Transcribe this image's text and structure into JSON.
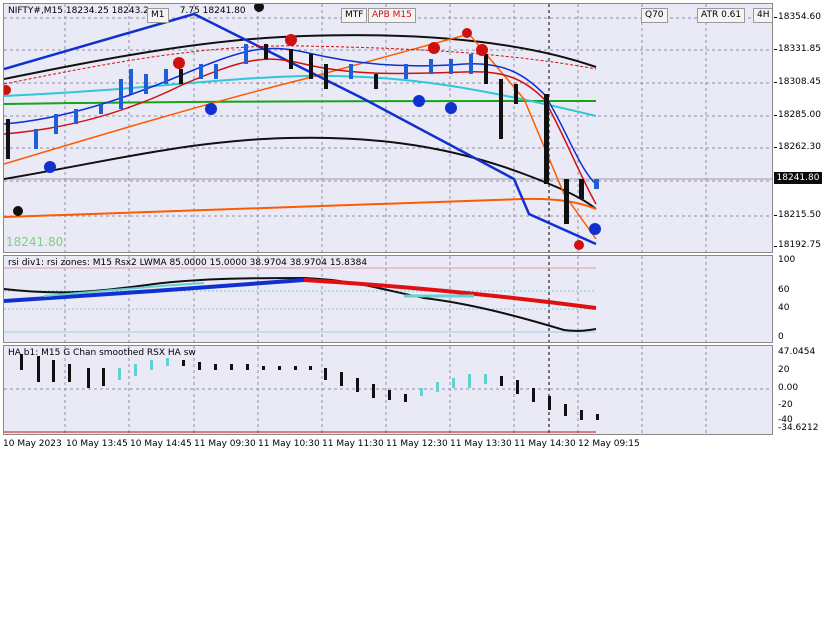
{
  "main": {
    "title": "NIFTY#,M15  18234.25 18243.2",
    "ohlc_extra": "7.75 18241.80",
    "timeframe_badge": "M1",
    "mtf_badge": "MTF",
    "apb_badge": "APB M15",
    "q_badge": "Q70",
    "atr_label": "ATR",
    "atr_value": "0.61",
    "h4_badge": "4H",
    "left_price_label": "18241.80",
    "current_price": "18241.80",
    "price_axis": [
      "18354.60",
      "18331.85",
      "18308.45",
      "18285.00",
      "18262.30",
      "18215.50",
      "18192.75"
    ],
    "colors": {
      "bg": "#eaeaf6",
      "up": "#1f5fd6",
      "down": "#111111",
      "red": "#d01010",
      "orange": "#ff5a00",
      "cyan": "#2ec8d6",
      "green": "#18a318"
    }
  },
  "rsi": {
    "title": "rsi div1: rsi zones: M15 Rsx2 LWMA 85.0000 15.0000 38.9704 38.9704 15.8384",
    "axis": [
      "100",
      "60",
      "40",
      "0"
    ]
  },
  "ha": {
    "title": "HA b1: M15 G Chan smoothed RSX HA sw",
    "axis": [
      "47.0454",
      "20",
      "0.00",
      "-20",
      "-40",
      "-34.6212"
    ]
  },
  "time_axis": [
    "10 May 2023",
    "10 May 13:45",
    "10 May 14:45",
    "11 May 09:30",
    "11 May 10:30",
    "11 May 11:30",
    "11 May 12:30",
    "11 May 13:30",
    "11 May 14:30",
    "12 May 09:15"
  ]
}
